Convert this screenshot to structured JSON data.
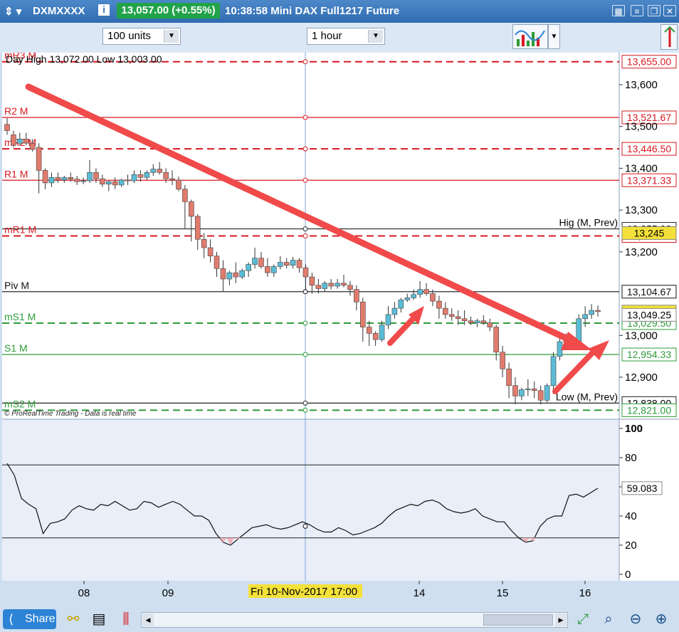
{
  "window": {
    "symbol": "DXMXXXX",
    "price_badge": "13,057.00 (+0.55%)",
    "title": "10:38:58 Mini DAX Full1217 Future"
  },
  "toolbar": {
    "units": "100 units",
    "timeframe": "1 hour"
  },
  "chart_data": {
    "type": "candlestick",
    "day_info": "Day High 13,072.00 Low 13,003.00",
    "attribution": "© ProRealTime Trading - Data is real time",
    "cursor_label": "Fri 10-Nov-2017 17:00",
    "price_axis": {
      "min": 12800,
      "max": 13670,
      "ticks": [
        "13,600",
        "13,500",
        "13,400",
        "13,300",
        "13,200",
        "13,000",
        "12,900"
      ]
    },
    "date_ticks": [
      "08",
      "09",
      "14",
      "15",
      "16"
    ],
    "levels": [
      {
        "name": "mR3 M",
        "value": 13655.0,
        "label": "13,655.00",
        "color": "#d71920",
        "style": "dash",
        "tag": "mR3 M"
      },
      {
        "name": "R2 M",
        "value": 13521.67,
        "label": "13,521.67",
        "color": "#d71920",
        "style": "solid",
        "tag": "R2 M"
      },
      {
        "name": "mR2 M",
        "value": 13446.5,
        "label": "13,446.50",
        "color": "#d71920",
        "style": "dash",
        "tag": "mR2 M"
      },
      {
        "name": "R1 M",
        "value": 13371.33,
        "label": "13,371.33",
        "color": "#d71920",
        "style": "solid",
        "tag": "R1 M"
      },
      {
        "name": "Hig (M, Prev)",
        "value": 13255.0,
        "label": "13,255.00",
        "color": "#222222",
        "style": "solid",
        "tag": "Hig (M, Prev)"
      },
      {
        "name": "mR1 M",
        "value": 13238.0,
        "label": "13,238.00",
        "color": "#d71920",
        "style": "dash",
        "tag": "mR1 M"
      },
      {
        "name": "Piv M",
        "value": 13104.67,
        "label": "13,104.67",
        "color": "#111111",
        "style": "solid",
        "tag": "Piv M"
      },
      {
        "name": "mS1 M",
        "value": 13029.5,
        "label": "13,029.50",
        "color": "#2e9b3a",
        "style": "dash",
        "tag": "mS1 M"
      },
      {
        "name": "S1 M",
        "value": 12954.33,
        "label": "12,954.33",
        "color": "#2e9b3a",
        "style": "solid",
        "tag": "S1 M"
      },
      {
        "name": "Low (M, Prev)",
        "value": 12838.0,
        "label": "12,838.00",
        "color": "#222222",
        "style": "solid",
        "tag": "Low (M, Prev)"
      },
      {
        "name": "mS2 M",
        "value": 12821.0,
        "label": "12,821.00",
        "color": "#2e9b3a",
        "style": "dash",
        "tag": "mS2 M"
      }
    ],
    "markers": [
      {
        "name": "last-price",
        "label": "13,057.00",
        "value": 13057.0,
        "bg": "#f3e13a"
      },
      {
        "name": "ref-price",
        "label": "13,049.25",
        "value": 13049.25,
        "bg": "#ffffff"
      },
      {
        "name": "alert-price",
        "label": "13,245",
        "value": 13245,
        "bg": "#f3e13a"
      }
    ],
    "candles": [
      [
        13505,
        13520,
        13490,
        13480
      ],
      [
        13480,
        13490,
        13455,
        13450
      ],
      [
        13460,
        13485,
        13470,
        13455
      ],
      [
        13470,
        13485,
        13460,
        13455
      ],
      [
        13460,
        13470,
        13445,
        13440
      ],
      [
        13450,
        13460,
        13395,
        13340
      ],
      [
        13395,
        13400,
        13365,
        13350
      ],
      [
        13365,
        13390,
        13378,
        13355
      ],
      [
        13378,
        13390,
        13372,
        13365
      ],
      [
        13372,
        13382,
        13378,
        13365
      ],
      [
        13378,
        13390,
        13374,
        13368
      ],
      [
        13374,
        13382,
        13368,
        13360
      ],
      [
        13368,
        13378,
        13370,
        13362
      ],
      [
        13370,
        13420,
        13390,
        13365
      ],
      [
        13390,
        13400,
        13375,
        13365
      ],
      [
        13375,
        13385,
        13362,
        13355
      ],
      [
        13362,
        13370,
        13368,
        13345
      ],
      [
        13368,
        13378,
        13360,
        13350
      ],
      [
        13360,
        13375,
        13372,
        13355
      ],
      [
        13372,
        13385,
        13370,
        13360
      ],
      [
        13370,
        13395,
        13385,
        13365
      ],
      [
        13385,
        13395,
        13378,
        13368
      ],
      [
        13378,
        13395,
        13390,
        13372
      ],
      [
        13390,
        13410,
        13398,
        13382
      ],
      [
        13398,
        13415,
        13390,
        13385
      ],
      [
        13390,
        13400,
        13375,
        13365
      ],
      [
        13375,
        13395,
        13372,
        13360
      ],
      [
        13372,
        13380,
        13350,
        13345
      ],
      [
        13350,
        13360,
        13320,
        13255
      ],
      [
        13320,
        13325,
        13285,
        13225
      ],
      [
        13285,
        13290,
        13230,
        13205
      ],
      [
        13230,
        13245,
        13210,
        13185
      ],
      [
        13210,
        13230,
        13190,
        13175
      ],
      [
        13190,
        13200,
        13160,
        13140
      ],
      [
        13160,
        13180,
        13135,
        13105
      ],
      [
        13135,
        13155,
        13150,
        13120
      ],
      [
        13150,
        13175,
        13140,
        13125
      ],
      [
        13140,
        13160,
        13155,
        13135
      ],
      [
        13155,
        13175,
        13170,
        13140
      ],
      [
        13170,
        13210,
        13185,
        13160
      ],
      [
        13185,
        13200,
        13165,
        13160
      ],
      [
        13165,
        13185,
        13150,
        13140
      ],
      [
        13150,
        13170,
        13165,
        13140
      ],
      [
        13165,
        13190,
        13175,
        13158
      ],
      [
        13175,
        13185,
        13168,
        13160
      ],
      [
        13168,
        13188,
        13180,
        13160
      ],
      [
        13180,
        13185,
        13162,
        13150
      ],
      [
        13162,
        13170,
        13140,
        13110
      ],
      [
        13140,
        13150,
        13120,
        13100
      ],
      [
        13120,
        13135,
        13112,
        13100
      ],
      [
        13112,
        13130,
        13125,
        13105
      ],
      [
        13125,
        13135,
        13118,
        13110
      ],
      [
        13118,
        13135,
        13125,
        13112
      ],
      [
        13125,
        13145,
        13120,
        13115
      ],
      [
        13120,
        13130,
        13110,
        13095
      ],
      [
        13110,
        13120,
        13080,
        13060
      ],
      [
        13080,
        13090,
        13020,
        12985
      ],
      [
        13020,
        13035,
        13005,
        12975
      ],
      [
        13005,
        13010,
        12990,
        12975
      ],
      [
        12990,
        13035,
        13025,
        12985
      ],
      [
        13025,
        13070,
        13050,
        13015
      ],
      [
        13050,
        13080,
        13065,
        13040
      ],
      [
        13065,
        13090,
        13085,
        13055
      ],
      [
        13085,
        13100,
        13090,
        13080
      ],
      [
        13090,
        13110,
        13098,
        13085
      ],
      [
        13098,
        13130,
        13110,
        13090
      ],
      [
        13110,
        13125,
        13100,
        13095
      ],
      [
        13100,
        13110,
        13082,
        13070
      ],
      [
        13082,
        13095,
        13065,
        13040
      ],
      [
        13065,
        13080,
        13050,
        13040
      ],
      [
        13050,
        13065,
        13045,
        13035
      ],
      [
        13045,
        13060,
        13040,
        13025
      ],
      [
        13040,
        13060,
        13035,
        13025
      ],
      [
        13035,
        13045,
        13030,
        13025
      ],
      [
        13030,
        13040,
        13035,
        13020
      ],
      [
        13035,
        13048,
        13030,
        13025
      ],
      [
        13030,
        13040,
        13020,
        13010
      ],
      [
        13020,
        13025,
        12960,
        12940
      ],
      [
        12960,
        12975,
        12920,
        12900
      ],
      [
        12920,
        12935,
        12880,
        12850
      ],
      [
        12880,
        12900,
        12855,
        12835
      ],
      [
        12855,
        12875,
        12870,
        12845
      ],
      [
        12870,
        12895,
        12872,
        12855
      ],
      [
        12872,
        12890,
        12868,
        12850
      ],
      [
        12868,
        12880,
        12845,
        12835
      ],
      [
        12845,
        12885,
        12880,
        12840
      ],
      [
        12880,
        12960,
        12950,
        12860
      ],
      [
        12950,
        13000,
        12985,
        12940
      ],
      [
        12985,
        13005,
        12990,
        12970
      ],
      [
        12990,
        13000,
        12985,
        12975
      ],
      [
        12985,
        13050,
        13040,
        12980
      ],
      [
        13040,
        13070,
        13050,
        13020
      ],
      [
        13050,
        13075,
        13060,
        13040
      ],
      [
        13060,
        13072,
        13057,
        13045
      ]
    ],
    "oscillator": {
      "ylim": [
        0,
        100
      ],
      "ticks": [
        "100",
        "80",
        "60",
        "40",
        "20",
        "0"
      ],
      "bands": [
        75,
        25
      ],
      "current": "59.083",
      "values": [
        76,
        68,
        52,
        48,
        45,
        28,
        35,
        36,
        38,
        44,
        47,
        45,
        44,
        48,
        47,
        50,
        47,
        44,
        45,
        50,
        49,
        46,
        48,
        50,
        48,
        44,
        40,
        40,
        37,
        28,
        22,
        20,
        24,
        28,
        32,
        33,
        34,
        32,
        31,
        32,
        34,
        36,
        34,
        31,
        29,
        29,
        32,
        30,
        27,
        28,
        30,
        32,
        35,
        40,
        44,
        46,
        48,
        47,
        50,
        51,
        49,
        45,
        43,
        42,
        43,
        45,
        40,
        38,
        36,
        36,
        30,
        25,
        22,
        23,
        33,
        38,
        40,
        40,
        54,
        55,
        53,
        56,
        59
      ]
    }
  },
  "bottombar": {
    "share_label": "Share"
  }
}
